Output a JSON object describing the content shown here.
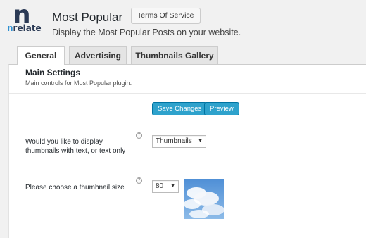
{
  "brand": {
    "logo_letter": "n",
    "logo_prefix": "n",
    "logo_rest": "relate"
  },
  "header": {
    "title": "Most Popular",
    "tos_label": "Terms Of Service",
    "subtitle": "Display the Most Popular Posts on your website."
  },
  "tabs": [
    {
      "label": "General",
      "active": true
    },
    {
      "label": "Advertising",
      "active": false
    },
    {
      "label": "Thumbnails Gallery",
      "active": false
    }
  ],
  "main": {
    "section_title": "Main Settings",
    "section_desc": "Main controls for Most Popular plugin.",
    "save_label": "Save Changes",
    "preview_label": "Preview",
    "help_glyph": "?",
    "fields": [
      {
        "label": "Would you like to display thumbnails with text, or text only",
        "value": "Thumbnails"
      },
      {
        "label": "Please choose a thumbnail size",
        "value": "80"
      }
    ],
    "caret": "▼"
  },
  "colors": {
    "accent": "#2ea2cc",
    "brand_dark": "#2b3a55",
    "brand_blue": "#2f8fd0"
  }
}
